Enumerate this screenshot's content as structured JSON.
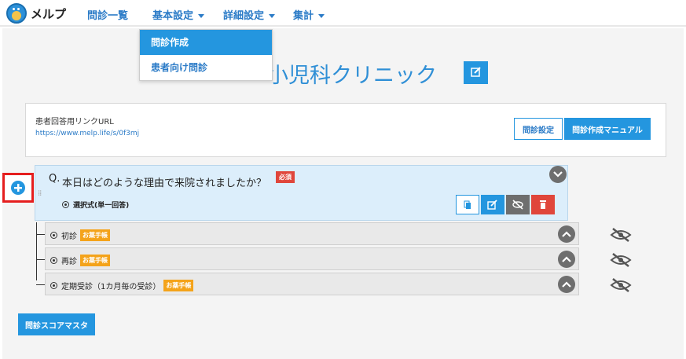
{
  "app": {
    "name": "メルプ"
  },
  "nav": {
    "items": [
      {
        "label": "問診一覧",
        "has_caret": false
      },
      {
        "label": "基本設定",
        "has_caret": true
      },
      {
        "label": "詳細設定",
        "has_caret": true
      },
      {
        "label": "集計",
        "has_caret": true
      }
    ]
  },
  "dropdown": {
    "items": [
      {
        "label": "問診作成",
        "active": true
      },
      {
        "label": "患者向け問診",
        "active": false
      }
    ]
  },
  "clinic": {
    "title": "小児科クリニック"
  },
  "link_box": {
    "label": "患者回答用リンクURL",
    "url": "https://www.melp.life/s/0f3mj",
    "settings_button": "問診設定",
    "manual_button": "問診作成マニュアル"
  },
  "question": {
    "prefix": "Q.",
    "text": "本日はどのような理由で来院されましたか？",
    "required_badge": "必須",
    "type_label": "選択式(単一回答)"
  },
  "options": [
    {
      "label": "初診",
      "tag": "お薬手帳"
    },
    {
      "label": "再診",
      "tag": "お薬手帳"
    },
    {
      "label": "定期受診（1カ月毎の受診）",
      "tag": "お薬手帳"
    }
  ],
  "footer": {
    "score_master_button": "問診スコアマスタ"
  },
  "colors": {
    "primary": "#2496df",
    "danger": "#e0463b",
    "warning": "#f4a31a",
    "highlight_border": "#e51e1e"
  }
}
